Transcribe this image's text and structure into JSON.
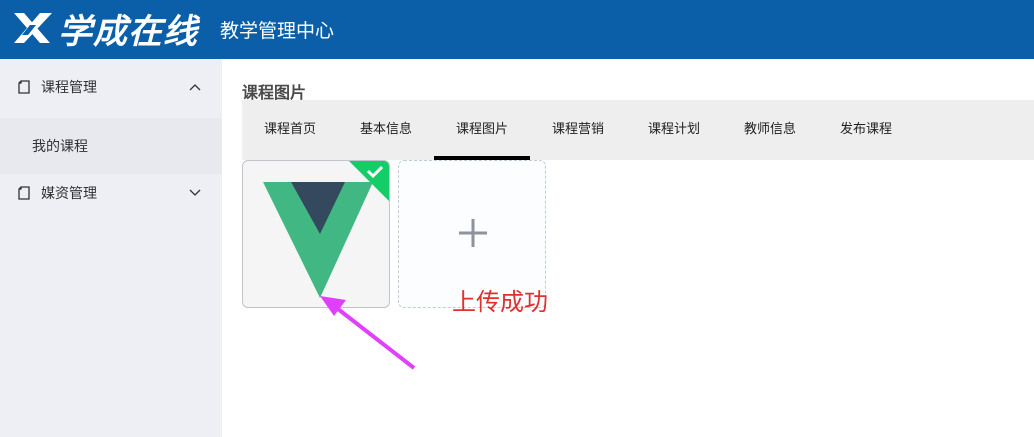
{
  "header": {
    "logo_text": "学成在线",
    "subtitle": "教学管理中心"
  },
  "sidebar": {
    "groups": [
      {
        "label": "课程管理",
        "icon": "document-icon",
        "arrow": "chevron-up-icon",
        "expanded": true,
        "items": [
          {
            "label": "我的课程"
          }
        ]
      },
      {
        "label": "媒资管理",
        "icon": "document-icon",
        "arrow": "chevron-down-icon",
        "expanded": false
      }
    ]
  },
  "main": {
    "title": "课程图片",
    "tabs": [
      {
        "label": "课程首页"
      },
      {
        "label": "基本信息"
      },
      {
        "label": "课程图片",
        "active": true
      },
      {
        "label": "课程营销"
      },
      {
        "label": "课程计划"
      },
      {
        "label": "教师信息"
      },
      {
        "label": "发布课程"
      }
    ],
    "uploaded_image_icon": "vue-logo-icon",
    "upload_icon": "plus-icon",
    "status_text": "上传成功"
  },
  "colors": {
    "header_bg": "#0a5fa8",
    "sidebar_bg": "#eeeff4",
    "tabs_bg": "#eeeeee",
    "success_badge": "#13ce66",
    "status_text": "#e03030",
    "annotation_arrow": "#e040fb",
    "vue_green": "#41b883",
    "vue_dark": "#35495e"
  }
}
